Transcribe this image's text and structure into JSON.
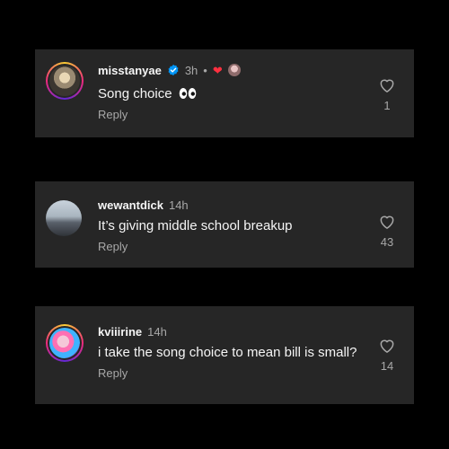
{
  "comments": [
    {
      "username": "misstanyae",
      "time": "3h",
      "separator": "•",
      "text": "Song choice",
      "reply_label": "Reply",
      "likes": "1",
      "verified": true,
      "avatar_icon": "profile-photo",
      "extras": [
        "heart-icon",
        "creator-avatar"
      ]
    },
    {
      "username": "wewantdick",
      "time": "14h",
      "text": "It’s giving middle school breakup",
      "reply_label": "Reply",
      "likes": "43",
      "avatar_icon": "profile-photo"
    },
    {
      "username": "kviiirine",
      "time": "14h",
      "text": "i take the song choice to mean bill is small?",
      "reply_label": "Reply",
      "likes": "14",
      "avatar_icon": "profile-photo"
    }
  ],
  "colors": {
    "background": "#000000",
    "card": "#262626",
    "primary_text": "#f5f5f5",
    "secondary_text": "#a8a8a8",
    "verified_blue": "#0095f6",
    "heart_red": "#ff3040"
  }
}
